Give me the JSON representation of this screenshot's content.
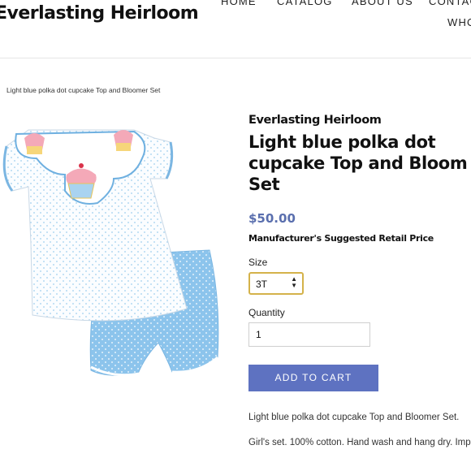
{
  "header": {
    "brand": "Everlasting Heirloom",
    "nav": [
      "HOME",
      "CATALOG",
      "ABOUT US",
      "CONTAC",
      "WHO"
    ]
  },
  "breadcrumb": "Light blue polka dot cupcake Top and Bloomer Set",
  "product": {
    "vendor": "Everlasting Heirloom",
    "title": "Light blue polka dot\ncupcake Top and Bloom\nSet",
    "price": "$50.00",
    "price_note": "Manufacturer's Suggested Retail Price",
    "size_label": "Size",
    "size_value": "3T",
    "quantity_label": "Quantity",
    "quantity_value": "1",
    "add_to_cart": "ADD TO CART",
    "description_1": "Light blue polka dot cupcake Top and Bloomer Set.",
    "description_2": "Girl's set. 100% cotton. Hand wash and hang dry. Imp"
  },
  "colors": {
    "price": "#5a6fae",
    "button": "#5e72c1",
    "select_border": "#d4b24a",
    "fabric_blue": "#8cc4ec"
  }
}
